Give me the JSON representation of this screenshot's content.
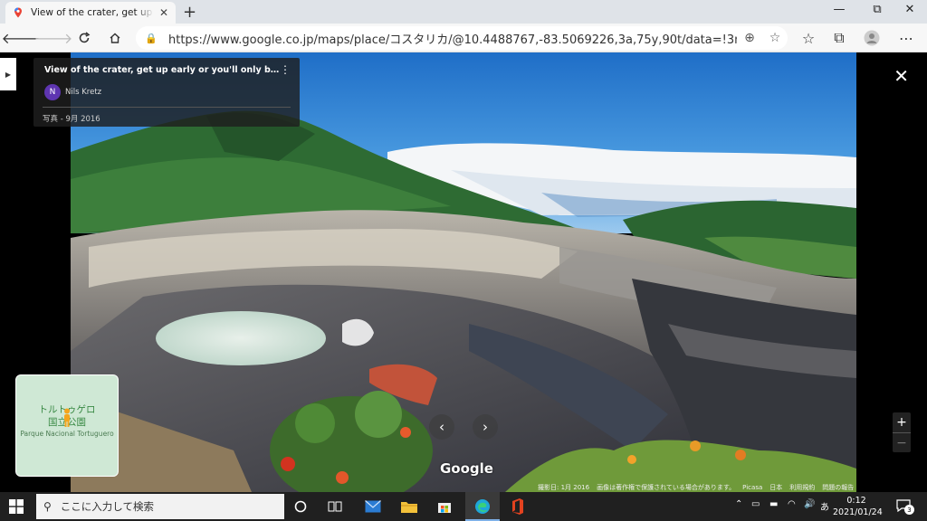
{
  "browser": {
    "tab_title": "View of the crater, get up early or you'll only be able to see...",
    "url": "https://www.google.co.jp/maps/place/コスタリカ/@10.4488767,-83.5069226,3a,75y,90t/data=!3m8!1e2!3m6!1...",
    "new_tab_label": "+",
    "win_min": "—",
    "win_max": "⧉",
    "win_close": "✕"
  },
  "photo_card": {
    "title": "View of the crater, get up early or you'll only be able to see...",
    "author_initial": "N",
    "author": "Nils Kretz",
    "date": "写真 - 9月 2016"
  },
  "minimap": {
    "label_line1": "トルトゥゲロ",
    "label_line2": "国立公園",
    "label_line3": "Parque Nacional Tortuguero"
  },
  "nav": {
    "prev": "‹",
    "next": "›"
  },
  "logo": "Google",
  "zoom": {
    "plus": "+",
    "minus": "−"
  },
  "attribution": {
    "shot_date": "撮影日: 1月 2016",
    "copyright": "画像は著作権で保護されている場合があります。",
    "provider": "Picasa",
    "country": "日本",
    "terms": "利用規約",
    "report": "問題の報告"
  },
  "taskbar": {
    "search_placeholder": "ここに入力して検索",
    "ime": "あ",
    "time": "0:12",
    "date": "2021/01/24",
    "notification_count": "3"
  },
  "colors": {
    "sky": "#2d78c8",
    "forest": "#2f6a34",
    "lake": "#cfe3d8",
    "taskbar": "#202020"
  }
}
